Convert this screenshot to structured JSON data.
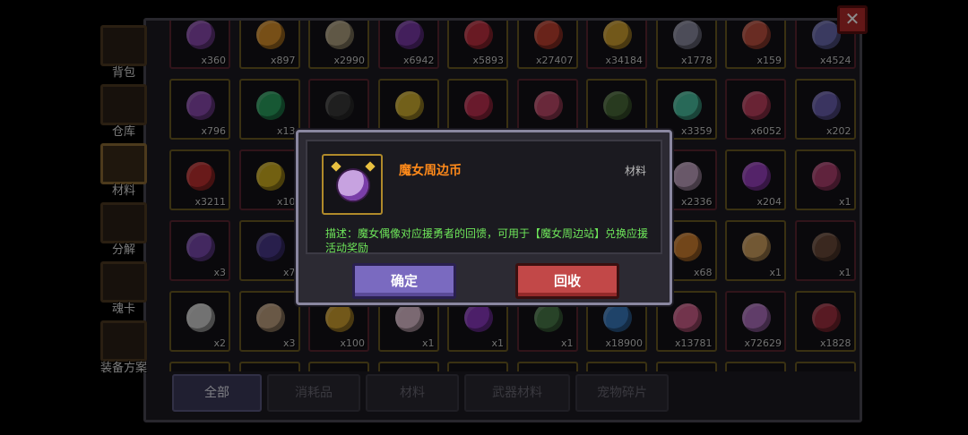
{
  "sidebar": {
    "items": [
      {
        "label": "背包",
        "icon": "backpack-icon"
      },
      {
        "label": "仓库",
        "icon": "warehouse-icon"
      },
      {
        "label": "材料",
        "icon": "materials-icon",
        "active": true
      },
      {
        "label": "分解",
        "icon": "decompose-icon"
      },
      {
        "label": "魂卡",
        "icon": "soul-card-icon"
      },
      {
        "label": "装备方案",
        "icon": "equipment-plan-icon"
      }
    ]
  },
  "close": {
    "label": "✕"
  },
  "grid": {
    "rows": [
      [
        "x360",
        "x897",
        "x2990",
        "x6942",
        "x5893",
        "x27407",
        "x34184",
        "x1778",
        "x159",
        "x4524"
      ],
      [
        "x796",
        "x13",
        "",
        "",
        "",
        "",
        "",
        "x3359",
        "x6052",
        "x202"
      ],
      [
        "x3211",
        "x10",
        "",
        "",
        "",
        "",
        "",
        "x2336",
        "x204",
        "x1"
      ],
      [
        "x3",
        "x7",
        "",
        "",
        "",
        "",
        "",
        "x68",
        "x1",
        "x1"
      ],
      [
        "x2",
        "x3",
        "x100",
        "x1",
        "x1",
        "x1",
        "x18900",
        "x13781",
        "x72629",
        "x1828"
      ]
    ],
    "colors": [
      [
        "#8a4ab0",
        "#d9902a",
        "#b0a080",
        "#7a3aa8",
        "#c03040",
        "#c04030",
        "#d0a030",
        "#8a8aa0",
        "#c05040",
        "#6a6ab0"
      ],
      [
        "#8a4ab0",
        "#2aa060",
        "#3a3a3a",
        "#d0b030",
        "#c03050",
        "#c04a6a",
        "#4a6a3a",
        "#4ac0a0",
        "#c04060",
        "#6a60b0"
      ],
      [
        "#c03030",
        "#d0b020",
        "#6a6a6a",
        "#4a4a4a",
        "#5a5a5a",
        "#5a5a5a",
        "#5a5a5a",
        "#c0a0c0",
        "#9a40c0",
        "#b04070"
      ],
      [
        "#7a4ab0",
        "#4a3a8a",
        "#5a5a5a",
        "#4a4a4a",
        "#5a5a5a",
        "#5a5a5a",
        "#5a5a5a",
        "#d08030",
        "#d0a060",
        "#6a4a3a"
      ],
      [
        "#d0d0d0",
        "#c0a080",
        "#d0a030",
        "#e0c0d0",
        "#8a3ac0",
        "#4a7a4a",
        "#3a7ac0",
        "#d0608a",
        "#b070c0",
        "#a03040"
      ]
    ]
  },
  "tabs": [
    {
      "label": "全部",
      "active": true
    },
    {
      "label": "消耗品"
    },
    {
      "label": "材料"
    },
    {
      "label": "武器材料"
    },
    {
      "label": "宠物碎片"
    }
  ],
  "dialog": {
    "item_name": "魔女周边币",
    "item_type": "材料",
    "description": "描述：魔女偶像对应援勇者的回馈，可用于【魔女周边站】兑换应援活动奖励",
    "ok_label": "确定",
    "recycle_label": "回收",
    "name_color": "#ff8a1a",
    "desc_color": "#6ee65a"
  }
}
